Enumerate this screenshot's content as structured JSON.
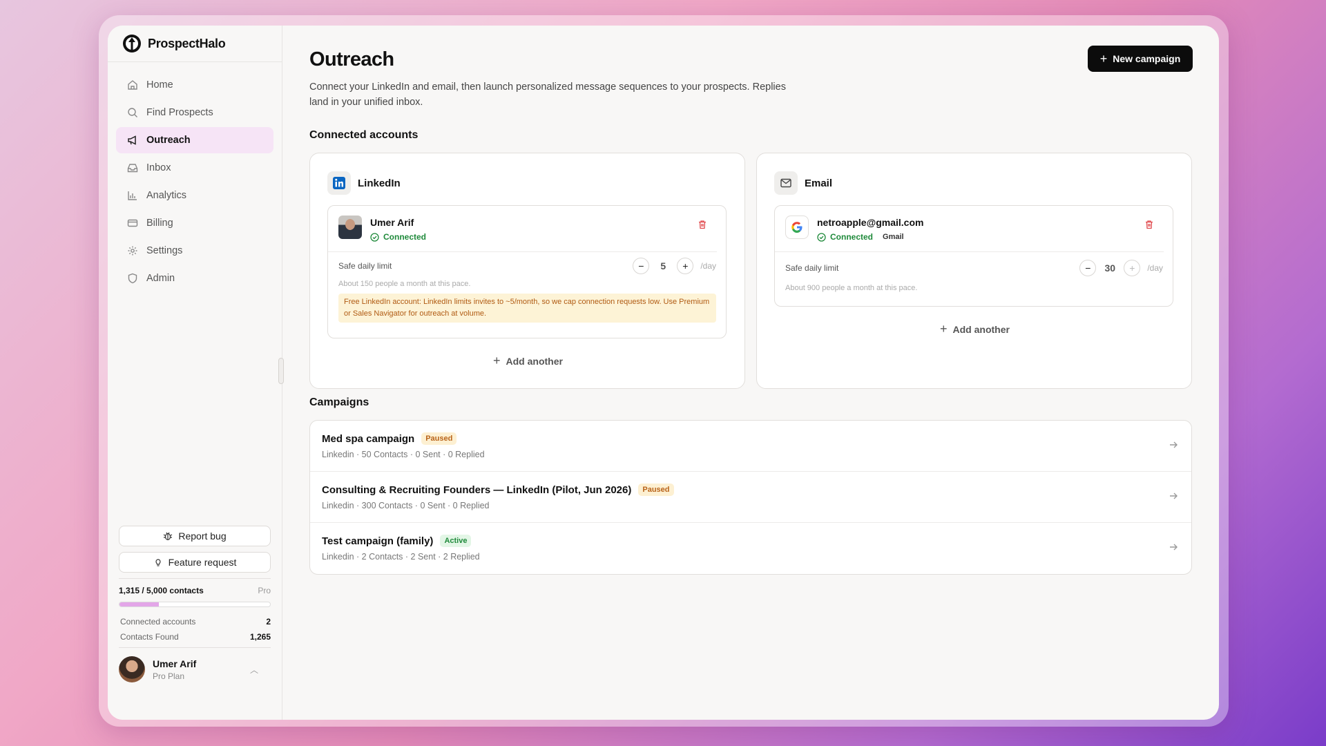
{
  "app": {
    "name": "ProspectHalo"
  },
  "sidebar": {
    "items": [
      {
        "label": "Home",
        "icon": "home-icon"
      },
      {
        "label": "Find Prospects",
        "icon": "search-icon"
      },
      {
        "label": "Outreach",
        "icon": "megaphone-icon",
        "active": true
      },
      {
        "label": "Inbox",
        "icon": "inbox-icon"
      },
      {
        "label": "Analytics",
        "icon": "bar-chart-icon"
      },
      {
        "label": "Billing",
        "icon": "credit-card-icon"
      },
      {
        "label": "Settings",
        "icon": "gear-icon"
      },
      {
        "label": "Admin",
        "icon": "shield-icon"
      }
    ],
    "report_bug": "Report bug",
    "feature_request": "Feature request",
    "usage": {
      "label": "1,315 / 5,000 contacts",
      "plan": "Pro",
      "fraction": 0.263
    },
    "stats": [
      {
        "label": "Connected accounts",
        "value": "2"
      },
      {
        "label": "Contacts Found",
        "value": "1,265"
      }
    ],
    "user": {
      "name": "Umer Arif",
      "plan": "Pro Plan"
    }
  },
  "main": {
    "title": "Outreach",
    "subtitle": "Connect your LinkedIn and email, then launch personalized message sequences to your prospects. Replies land in your unified inbox.",
    "new_campaign": "New campaign",
    "connected_title": "Connected accounts",
    "linkedin": {
      "title": "LinkedIn",
      "account_name": "Umer Arif",
      "status": "Connected",
      "limit_label": "Safe daily limit",
      "limit_value": "5",
      "per_day": "/day",
      "note": "About 150 people a month at this pace.",
      "warning": "Free LinkedIn account: LinkedIn limits invites to ~5/month, so we cap connection requests low. Use Premium or Sales Navigator for outreach at volume.",
      "add_another": "Add another"
    },
    "email": {
      "title": "Email",
      "account_name": "netroapple@gmail.com",
      "status": "Connected",
      "provider": "Gmail",
      "limit_label": "Safe daily limit",
      "limit_value": "30",
      "per_day": "/day",
      "note": "About 900 people a month at this pace.",
      "add_another": "Add another"
    },
    "campaigns_title": "Campaigns",
    "campaigns": [
      {
        "name": "Med spa campaign",
        "status": "Paused",
        "meta": "Linkedin · 50 Contacts · 0 Sent · 0 Replied"
      },
      {
        "name": "Consulting & Recruiting Founders — LinkedIn (Pilot, Jun 2026)",
        "status": "Paused",
        "meta": "Linkedin · 300 Contacts · 0 Sent · 0 Replied"
      },
      {
        "name": "Test campaign (family)",
        "status": "Active",
        "meta": "Linkedin · 2 Contacts · 2 Sent · 2 Replied"
      }
    ]
  }
}
